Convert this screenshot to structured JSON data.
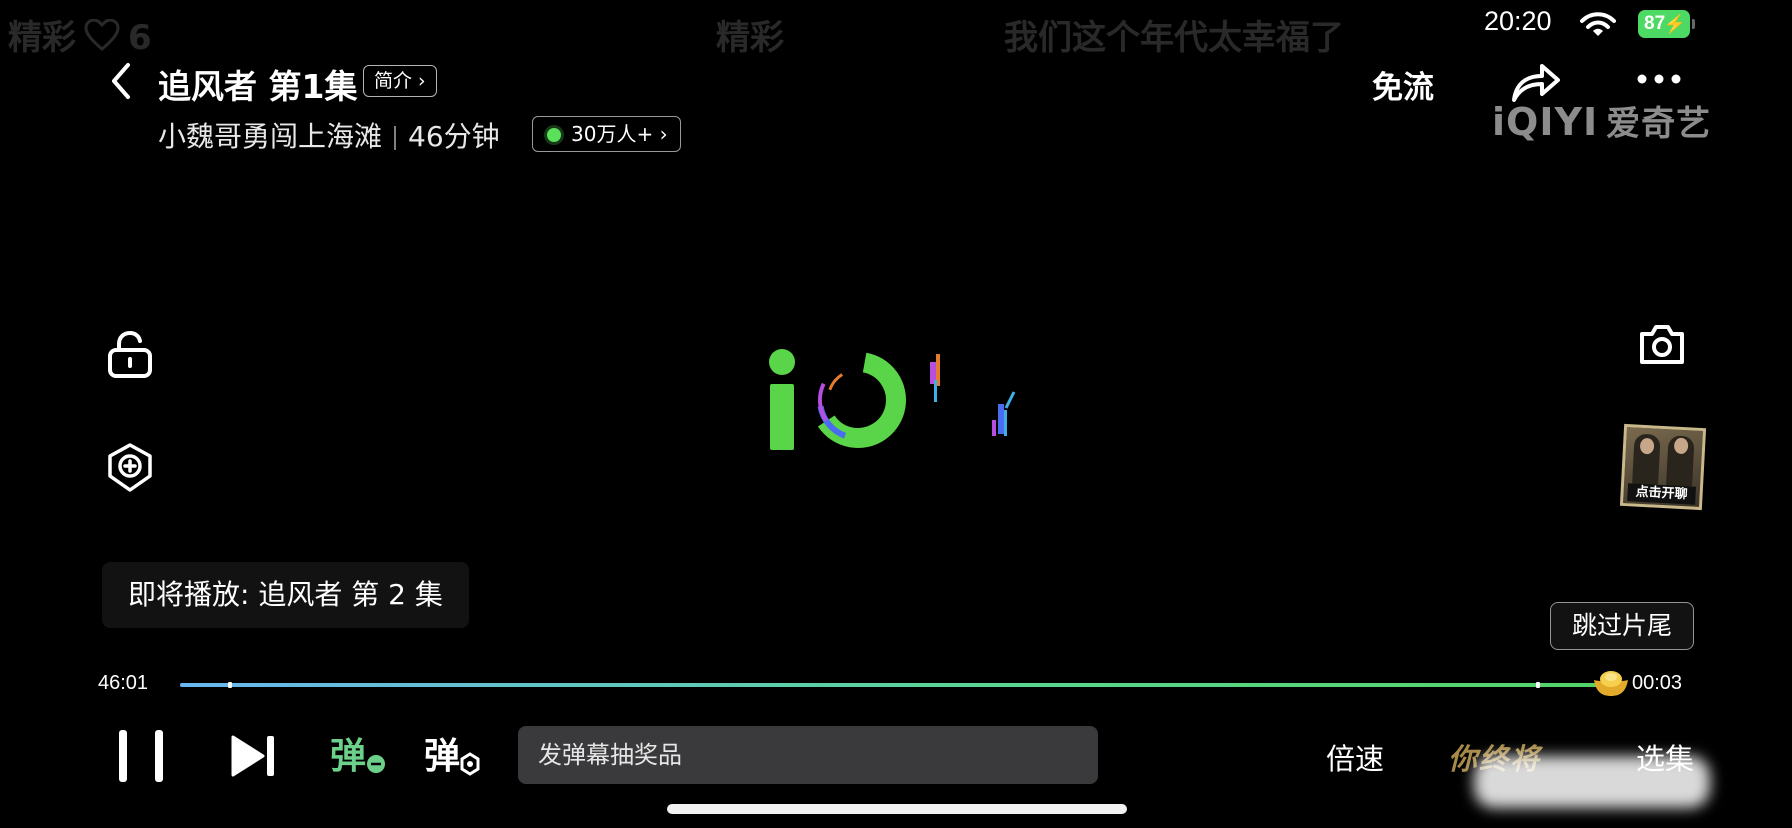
{
  "danmaku": [
    {
      "text": "精彩",
      "count": "6"
    },
    {
      "text": "精彩"
    },
    {
      "text": "我们这个年代太幸福了"
    }
  ],
  "status_bar": {
    "time": "20:20",
    "battery": "87"
  },
  "header": {
    "title": "追风者 第1集",
    "intro_label": "简介 ›",
    "episode_subtitle": "小魏哥勇闯上海滩",
    "duration": "46分钟",
    "viewers": "30万人+ ›",
    "free_flow_label": "免流"
  },
  "watermark": {
    "brand": "iQIYI",
    "cn": "爱奇艺"
  },
  "side": {
    "chat_thumb_label": "点击开聊"
  },
  "next_up": "即将播放: 追风者 第 2 集",
  "skip_label": "跳过片尾",
  "progress": {
    "elapsed": "46:01",
    "remaining": "00:03",
    "fraction": 0.998
  },
  "danmaku_input": {
    "placeholder": "发弹幕抽奖品"
  },
  "bottom": {
    "speed_label": "倍速",
    "promo_text": "你终将",
    "episodes_label": "选集"
  },
  "icons": [
    "back-icon",
    "share-icon",
    "more-icon",
    "lock-icon",
    "ai-icon",
    "camera-icon",
    "pause-icon",
    "next-episode-icon",
    "danmaku-toggle-icon",
    "danmaku-settings-icon",
    "wifi-icon",
    "heart-icon"
  ],
  "colors": {
    "accent_green": "#5be05b",
    "progress_blue": "#69b7f0",
    "battery": "#4cd964",
    "gold": "#c6a355"
  }
}
